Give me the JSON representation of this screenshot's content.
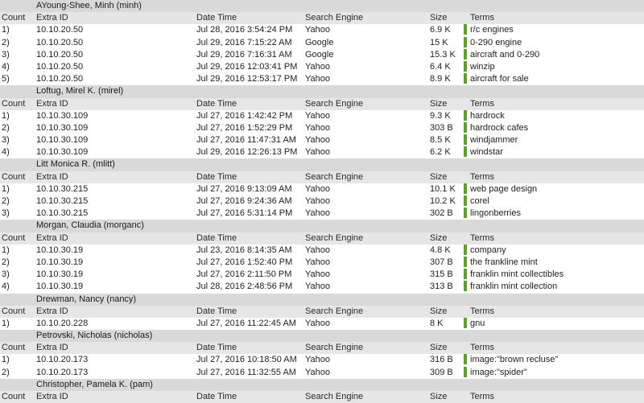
{
  "columns": {
    "count": "Count",
    "extra_id": "Extra ID",
    "date_time": "Date Time",
    "search_engine": "Search Engine",
    "size": "Size",
    "terms": "Terms"
  },
  "colors": {
    "user_header_bg": "#d9d9d9",
    "column_header_bg": "#e6e6e6",
    "term_bar": "#5ea02a"
  },
  "groups": [
    {
      "user": "AYoung-Shee, Minh (minh)",
      "rows": [
        {
          "count": "1)",
          "extra_id": "10.10.20.50",
          "date_time": "Jul 28, 2016 3:54:24 PM",
          "engine": "Yahoo",
          "size": "6.9 K",
          "terms": "r/c engines"
        },
        {
          "count": "2)",
          "extra_id": "10.10.20.50",
          "date_time": "Jul 29, 2016 7:15:22 AM",
          "engine": "Google",
          "size": "15 K",
          "terms": "0-290 engine"
        },
        {
          "count": "3)",
          "extra_id": "10.10.20.50",
          "date_time": "Jul 29, 2016 7:16:31 AM",
          "engine": "Google",
          "size": "15.3 K",
          "terms": "aircraft and 0-290"
        },
        {
          "count": "4)",
          "extra_id": "10.10.20.50",
          "date_time": "Jul 29, 2016 12:03:41 PM",
          "engine": "Yahoo",
          "size": "6.4 K",
          "terms": "winzip"
        },
        {
          "count": "5)",
          "extra_id": "10.10.20.50",
          "date_time": "Jul 29, 2016 12:53:17 PM",
          "engine": "Yahoo",
          "size": "8.9 K",
          "terms": "aircraft for sale"
        }
      ]
    },
    {
      "user": "Loftug, Mirel K. (mirel)",
      "rows": [
        {
          "count": "1)",
          "extra_id": "10.10.30.109",
          "date_time": "Jul 27, 2016 1:42:42 PM",
          "engine": "Yahoo",
          "size": "9.3 K",
          "terms": "hardrock"
        },
        {
          "count": "2)",
          "extra_id": "10.10.30.109",
          "date_time": "Jul 27, 2016 1:52:29 PM",
          "engine": "Yahoo",
          "size": "303 B",
          "terms": "hardrock cafes"
        },
        {
          "count": "3)",
          "extra_id": "10.10.30.109",
          "date_time": "Jul 27, 2016 11:47:31 AM",
          "engine": "Yahoo",
          "size": "8.5 K",
          "terms": "windjammer"
        },
        {
          "count": "4)",
          "extra_id": "10.10.30.109",
          "date_time": "Jul 29, 2016 12:26:13 PM",
          "engine": "Yahoo",
          "size": "6.2 K",
          "terms": "windstar"
        }
      ]
    },
    {
      "user": "Litt Monica R. (mlitt)",
      "rows": [
        {
          "count": "1)",
          "extra_id": "10.10.30.215",
          "date_time": "Jul 27, 2016 9:13:09 AM",
          "engine": "Yahoo",
          "size": "10.1 K",
          "terms": "web page design"
        },
        {
          "count": "2)",
          "extra_id": "10.10.30.215",
          "date_time": "Jul 27, 2016 9:24:36 AM",
          "engine": "Yahoo",
          "size": "10.2 K",
          "terms": "corel"
        },
        {
          "count": "3)",
          "extra_id": "10.10.30.215",
          "date_time": "Jul 27, 2016 5:31:14 PM",
          "engine": "Yahoo",
          "size": "302 B",
          "terms": "lingonberries"
        }
      ]
    },
    {
      "user": "Morgan, Claudia (morganc)",
      "rows": [
        {
          "count": "1)",
          "extra_id": "10.10.30.19",
          "date_time": "Jul 23, 2016 8:14:35 AM",
          "engine": "Yahoo",
          "size": "4.8 K",
          "terms": "company"
        },
        {
          "count": "2)",
          "extra_id": "10.10.30.19",
          "date_time": "Jul 27, 2016 1:52:40 PM",
          "engine": "Yahoo",
          "size": "307 B",
          "terms": "the frankline mint"
        },
        {
          "count": "3)",
          "extra_id": "10.10.30.19",
          "date_time": "Jul 27, 2016 2:11:50 PM",
          "engine": "Yahoo",
          "size": "315 B",
          "terms": "franklin mint collectibles"
        },
        {
          "count": "4)",
          "extra_id": "10.10.30.19",
          "date_time": "Jul 28, 2016 2:48:56 PM",
          "engine": "Yahoo",
          "size": "313 B",
          "terms": "franklin mint collection"
        }
      ]
    },
    {
      "user": "Drewman, Nancy (nancy)",
      "rows": [
        {
          "count": "1)",
          "extra_id": "10.10.20.228",
          "date_time": "Jul 27, 2016 11:22:45 AM",
          "engine": "Yahoo",
          "size": "8 K",
          "terms": "gnu"
        }
      ]
    },
    {
      "user": "Petrovski, Nicholas (nicholas)",
      "rows": [
        {
          "count": "1)",
          "extra_id": "10.10.20.173",
          "date_time": "Jul 27, 2016 10:18:50 AM",
          "engine": "Yahoo",
          "size": "316 B",
          "terms": "image:\"brown recluse\""
        },
        {
          "count": "2)",
          "extra_id": "10.10.20.173",
          "date_time": "Jul 27, 2016 11:32:55 AM",
          "engine": "Yahoo",
          "size": "309 B",
          "terms": "image:\"spider\""
        }
      ]
    },
    {
      "user": "Christopher, Pamela K. (pam)",
      "rows": []
    }
  ]
}
